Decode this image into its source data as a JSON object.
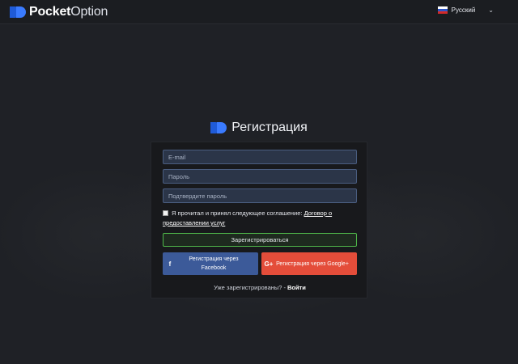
{
  "header": {
    "brand_bold": "Pocket",
    "brand_light": "Option",
    "language": "Русский"
  },
  "title": "Регистрация",
  "form": {
    "email_placeholder": "E-mail",
    "password_placeholder": "Пароль",
    "confirm_placeholder": "Подтвердите пароль",
    "agree_text": "Я прочитал и принял следующее соглашение:",
    "agree_link": "Договор о предоставлении услуг",
    "register_label": "Зарегистрироваться",
    "facebook_label": "Регистрация через Facebook",
    "google_label": "Регистрация через Google+",
    "already_text": "Уже зарегистрированы?",
    "separator": "-",
    "login_label": "Войти"
  },
  "icons": {
    "facebook": "f",
    "google": "G+",
    "chevron": "⌄"
  },
  "colors": {
    "brand_blue": "#1f5bd8",
    "facebook": "#3c5a99",
    "google": "#e44d3a",
    "register_border": "#4fb84a"
  }
}
